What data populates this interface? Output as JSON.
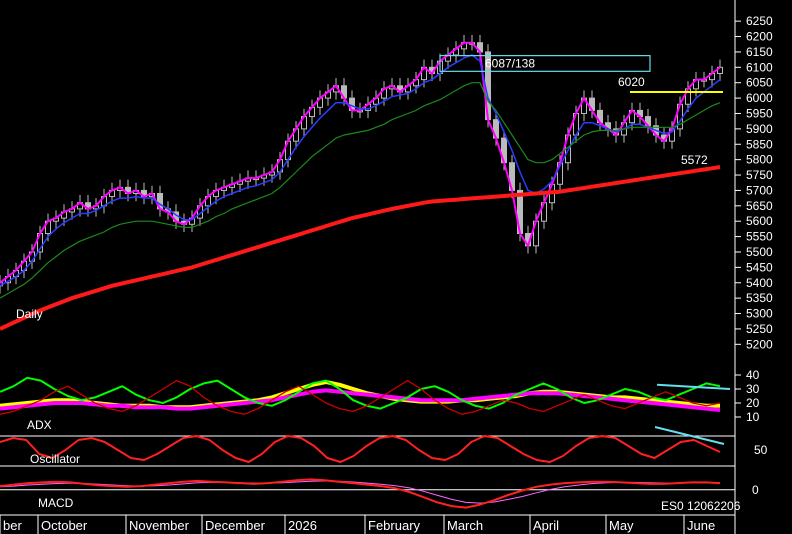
{
  "chart_data": {
    "type": "line",
    "price_panel": {
      "label": "Daily",
      "y_ticks": [
        5200,
        5250,
        5300,
        5350,
        5400,
        5450,
        5500,
        5550,
        5600,
        5650,
        5700,
        5750,
        5800,
        5850,
        5900,
        5950,
        6000,
        6050,
        6100,
        6150,
        6200,
        6250
      ],
      "ylim": [
        5175,
        6270
      ],
      "annotations": {
        "box_label": "6087/138",
        "level_label": "6020",
        "ma200_label": "5572"
      },
      "close": [
        5400,
        5420,
        5440,
        5470,
        5500,
        5560,
        5600,
        5610,
        5630,
        5640,
        5660,
        5640,
        5650,
        5680,
        5700,
        5710,
        5690,
        5700,
        5680,
        5690,
        5640,
        5630,
        5600,
        5590,
        5610,
        5650,
        5680,
        5700,
        5710,
        5720,
        5730,
        5740,
        5740,
        5750,
        5760,
        5800,
        5860,
        5900,
        5940,
        5970,
        6000,
        6020,
        6040,
        6000,
        5960,
        5960,
        5980,
        6000,
        6030,
        6040,
        6020,
        6040,
        6060,
        6100,
        6080,
        6120,
        6140,
        6160,
        6180,
        6180,
        6150,
        5930,
        5870,
        5790,
        5700,
        5560,
        5520,
        5600,
        5660,
        5720,
        5790,
        5880,
        5950,
        6000,
        5960,
        5920,
        5900,
        5880,
        5920,
        5960,
        5940,
        5910,
        5880,
        5860,
        5900,
        5980,
        6030,
        6060,
        6060,
        6080,
        6100
      ]
    },
    "moving_averages": [
      {
        "color": "#ff00ff",
        "values": [
          5400,
          5420,
          5440,
          5470,
          5500,
          5560,
          5600,
          5610,
          5630,
          5640,
          5660,
          5640,
          5650,
          5680,
          5700,
          5710,
          5690,
          5700,
          5680,
          5690,
          5640,
          5630,
          5600,
          5590,
          5610,
          5650,
          5680,
          5700,
          5710,
          5720,
          5730,
          5740,
          5740,
          5750,
          5760,
          5800,
          5860,
          5900,
          5940,
          5970,
          6000,
          6020,
          6040,
          6000,
          5960,
          5960,
          5980,
          6000,
          6030,
          6040,
          6020,
          6040,
          6060,
          6100,
          6080,
          6120,
          6140,
          6160,
          6180,
          6180,
          6150,
          5930,
          5870,
          5790,
          5700,
          5560,
          5520,
          5600,
          5660,
          5720,
          5790,
          5880,
          5950,
          6000,
          5960,
          5920,
          5900,
          5880,
          5920,
          5960,
          5940,
          5910,
          5880,
          5860,
          5900,
          5980,
          6030,
          6060,
          6060,
          6080,
          6100
        ]
      },
      {
        "color": "#2a3cff",
        "values": [
          5390,
          5405,
          5420,
          5440,
          5470,
          5510,
          5550,
          5575,
          5595,
          5610,
          5625,
          5625,
          5635,
          5650,
          5665,
          5675,
          5675,
          5680,
          5675,
          5675,
          5655,
          5640,
          5620,
          5605,
          5605,
          5625,
          5645,
          5665,
          5680,
          5690,
          5700,
          5710,
          5715,
          5725,
          5735,
          5760,
          5800,
          5840,
          5875,
          5905,
          5935,
          5960,
          5985,
          5985,
          5975,
          5965,
          5965,
          5975,
          5990,
          6005,
          6010,
          6015,
          6030,
          6050,
          6060,
          6080,
          6100,
          6115,
          6130,
          6140,
          6120,
          6000,
          5950,
          5890,
          5830,
          5760,
          5700,
          5690,
          5705,
          5730,
          5780,
          5830,
          5880,
          5920,
          5920,
          5910,
          5900,
          5890,
          5900,
          5915,
          5915,
          5905,
          5895,
          5885,
          5890,
          5925,
          5965,
          6000,
          6020,
          6040,
          6060
        ]
      },
      {
        "color": "#1a8a1a",
        "values": [
          5350,
          5365,
          5380,
          5395,
          5415,
          5440,
          5465,
          5485,
          5505,
          5520,
          5535,
          5545,
          5555,
          5565,
          5580,
          5590,
          5595,
          5600,
          5600,
          5600,
          5595,
          5590,
          5585,
          5580,
          5580,
          5590,
          5600,
          5615,
          5625,
          5640,
          5650,
          5660,
          5670,
          5680,
          5690,
          5710,
          5735,
          5760,
          5785,
          5810,
          5830,
          5850,
          5870,
          5880,
          5885,
          5890,
          5895,
          5905,
          5915,
          5930,
          5940,
          5950,
          5960,
          5975,
          5985,
          5995,
          6010,
          6025,
          6040,
          6050,
          6050,
          5990,
          5960,
          5920,
          5880,
          5840,
          5800,
          5790,
          5790,
          5800,
          5820,
          5840,
          5860,
          5880,
          5890,
          5895,
          5895,
          5895,
          5900,
          5905,
          5905,
          5905,
          5905,
          5905,
          5905,
          5915,
          5930,
          5945,
          5960,
          5975,
          5985
        ]
      },
      {
        "color": "#ff1a1a",
        "values": [
          5250,
          5262,
          5274,
          5286,
          5298,
          5310,
          5320,
          5330,
          5340,
          5350,
          5358,
          5366,
          5374,
          5382,
          5390,
          5396,
          5402,
          5408,
          5414,
          5420,
          5426,
          5432,
          5438,
          5444,
          5450,
          5458,
          5466,
          5474,
          5482,
          5490,
          5498,
          5506,
          5514,
          5522,
          5530,
          5538,
          5546,
          5554,
          5562,
          5570,
          5578,
          5586,
          5594,
          5602,
          5610,
          5616,
          5622,
          5628,
          5634,
          5640,
          5645,
          5650,
          5655,
          5660,
          5664,
          5666,
          5668,
          5670,
          5672,
          5674,
          5676,
          5678,
          5680,
          5682,
          5684,
          5686,
          5688,
          5690,
          5692,
          5694,
          5696,
          5700,
          5704,
          5708,
          5712,
          5716,
          5720,
          5724,
          5728,
          5732,
          5736,
          5740,
          5744,
          5748,
          5752,
          5756,
          5760,
          5764,
          5768,
          5772,
          5776
        ]
      }
    ],
    "adx_panel": {
      "label": "ADX",
      "y_ticks": [
        10,
        20,
        30,
        40
      ],
      "ylim": [
        5,
        45
      ],
      "series": [
        {
          "color": "#ffff00",
          "values": [
            18,
            19,
            20,
            21,
            22,
            22,
            21,
            20,
            19,
            18,
            18,
            18,
            17,
            17,
            17,
            18,
            19,
            20,
            21,
            22,
            24,
            27,
            30,
            33,
            35,
            33,
            30,
            27,
            25,
            23,
            22,
            21,
            21,
            21,
            22,
            22,
            23,
            24,
            25,
            27,
            28,
            28,
            27,
            26,
            25,
            24,
            24,
            23,
            22,
            21,
            20,
            19,
            18,
            18
          ]
        },
        {
          "color": "#ff00ff",
          "values": [
            16,
            17,
            18,
            19,
            20,
            20,
            20,
            19,
            18,
            18,
            17,
            17,
            17,
            16,
            16,
            17,
            18,
            19,
            20,
            21,
            22,
            24,
            26,
            28,
            29,
            28,
            27,
            26,
            25,
            24,
            23,
            22,
            22,
            22,
            22,
            23,
            24,
            25,
            26,
            27,
            27,
            27,
            26,
            25,
            24,
            23,
            22,
            21,
            20,
            19,
            18,
            17,
            16,
            15
          ]
        },
        {
          "color": "#00ff00",
          "values": [
            28,
            32,
            38,
            36,
            30,
            25,
            22,
            24,
            28,
            32,
            26,
            22,
            20,
            24,
            30,
            34,
            36,
            30,
            24,
            20,
            18,
            22,
            28,
            34,
            36,
            30,
            22,
            18,
            16,
            20,
            24,
            30,
            32,
            28,
            22,
            18,
            16,
            20,
            26,
            30,
            34,
            30,
            24,
            20,
            22,
            26,
            30,
            28,
            24,
            22,
            26,
            30,
            34,
            32
          ]
        },
        {
          "color": "#cc0000",
          "values": [
            12,
            14,
            18,
            22,
            28,
            32,
            26,
            20,
            16,
            14,
            18,
            24,
            30,
            36,
            32,
            24,
            18,
            14,
            12,
            16,
            22,
            28,
            32,
            26,
            20,
            16,
            14,
            18,
            24,
            30,
            36,
            30,
            22,
            16,
            12,
            14,
            18,
            22,
            20,
            16,
            14,
            18,
            22,
            26,
            22,
            18,
            16,
            20,
            24,
            28,
            24,
            20,
            18,
            20
          ]
        }
      ]
    },
    "oscillator_panel": {
      "label": "Oscillator",
      "y_ticks": [
        50
      ],
      "ylim": [
        0,
        100
      ],
      "values": [
        70,
        80,
        75,
        40,
        30,
        50,
        75,
        80,
        70,
        50,
        30,
        25,
        40,
        60,
        80,
        85,
        75,
        50,
        30,
        20,
        40,
        70,
        85,
        80,
        60,
        30,
        20,
        35,
        60,
        80,
        85,
        75,
        50,
        30,
        25,
        40,
        70,
        85,
        80,
        60,
        40,
        25,
        20,
        35,
        60,
        80,
        85,
        80,
        60,
        40,
        30,
        50,
        70,
        75,
        60,
        45
      ]
    },
    "macd_panel": {
      "label": "MACD",
      "y_ticks": [
        0
      ],
      "ylim": [
        -60,
        40
      ],
      "macd": [
        10,
        14,
        18,
        20,
        22,
        20,
        16,
        12,
        10,
        8,
        10,
        14,
        18,
        22,
        24,
        22,
        20,
        18,
        16,
        18,
        22,
        26,
        28,
        26,
        22,
        18,
        14,
        10,
        4,
        -6,
        -20,
        -34,
        -44,
        -48,
        -40,
        -28,
        -14,
        -2,
        8,
        14,
        18,
        20,
        22,
        22,
        20,
        18,
        16,
        16,
        18,
        20,
        20,
        18
      ],
      "signal": [
        8,
        10,
        13,
        15,
        17,
        18,
        17,
        15,
        13,
        11,
        10,
        11,
        13,
        16,
        19,
        20,
        20,
        19,
        18,
        18,
        19,
        21,
        23,
        24,
        23,
        21,
        18,
        15,
        11,
        5,
        -4,
        -15,
        -26,
        -34,
        -36,
        -33,
        -26,
        -18,
        -8,
        1,
        8,
        13,
        17,
        19,
        20,
        20,
        19,
        18,
        18,
        19,
        19,
        19
      ]
    },
    "x_labels": [
      "ber",
      "October",
      "November",
      "December",
      "2026",
      "February",
      "March",
      "April",
      "May",
      "June"
    ],
    "footer_code": "ES0 12062206"
  }
}
